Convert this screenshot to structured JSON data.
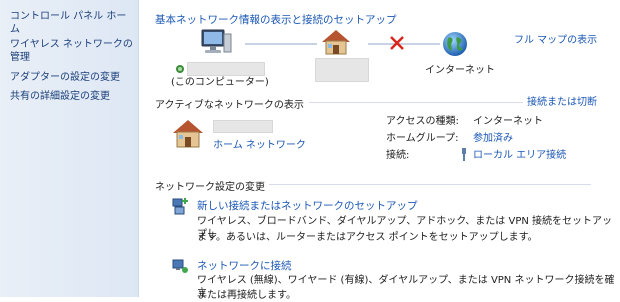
{
  "sidebar": {
    "items": [
      {
        "label": "コントロール パネル ホーム"
      },
      {
        "label": "ワイヤレス ネットワークの管理"
      },
      {
        "label": "アダプターの設定の変更"
      },
      {
        "label": "共有の詳細設定の変更"
      }
    ]
  },
  "header": {
    "title": "基本ネットワーク情報の表示と接続のセットアップ",
    "full_map_label": "フル マップの表示"
  },
  "map": {
    "computer_label": "(このコンピューター)",
    "internet_label": "インターネット"
  },
  "active": {
    "section_title": "アクティブなネットワークの表示",
    "connect_link": "接続または切断",
    "network_type": "ホーム ネットワーク",
    "access_label": "アクセスの種類:",
    "access_value": "インターネット",
    "homegroup_label": "ホームグループ:",
    "homegroup_value": "参加済み",
    "connection_label": "接続:",
    "connection_value": "ローカル エリア接続"
  },
  "settings": {
    "section_title": "ネットワーク設定の変更",
    "items": [
      {
        "title": "新しい接続またはネットワークのセットアップ",
        "desc1": "ワイヤレス、ブロードバンド、ダイヤルアップ、アドホック、または VPN 接続をセットアップし",
        "desc2": "ます。あるいは、ルーターまたはアクセス ポイントをセットアップします。"
      },
      {
        "title": "ネットワークに接続",
        "desc1": "ワイヤレス (無線)、ワイヤード (有線)、ダイヤルアップ、または VPN ネットワーク接続を確立",
        "desc2": "または再接続します。"
      }
    ]
  },
  "colors": {
    "link": "#1a57b5",
    "sidebar_bg": "#e3ebf6",
    "error_x": "#d9261c"
  },
  "icons": [
    "computer-icon",
    "house-icon",
    "globe-icon",
    "x-icon",
    "network-wizard-icon",
    "network-connect-icon",
    "plug-icon",
    "network-connector-icon"
  ]
}
